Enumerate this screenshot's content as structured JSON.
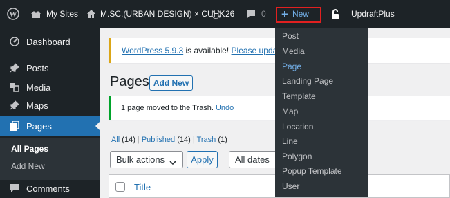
{
  "adminbar": {
    "my_sites": "My Sites",
    "site_name": "M.SC.(URBAN DESIGN) × CUHK",
    "updates_count": "26",
    "comments_count": "0",
    "new_label": "New",
    "plugin_label": "UpdraftPlus"
  },
  "sidebar": {
    "items": [
      {
        "label": "Dashboard",
        "icon": "dashboard-icon"
      },
      {
        "label": "Posts",
        "icon": "pin-icon"
      },
      {
        "label": "Media",
        "icon": "media-icon"
      },
      {
        "label": "Maps",
        "icon": "pin-icon"
      },
      {
        "label": "Pages",
        "icon": "pages-icon"
      },
      {
        "label": "Comments",
        "icon": "comment-icon"
      }
    ],
    "submenu": [
      "All Pages",
      "Add New"
    ]
  },
  "main": {
    "update_notice": {
      "version_link": "WordPress 5.9.3",
      "text": " is available! ",
      "action_link": "Please upda"
    },
    "title": "Pages",
    "add_new": "Add New",
    "trash_notice": {
      "text": "1 page moved to the Trash. ",
      "undo": "Undo"
    },
    "filters": {
      "all": "All",
      "all_count": " (14)",
      "sep1": " | ",
      "published": "Published",
      "published_count": " (14)",
      "sep2": " | ",
      "trash": "Trash",
      "trash_count": " (1)"
    },
    "bulk_actions": "Bulk actions",
    "apply": "Apply",
    "all_dates": "All dates",
    "column_title": "Title"
  },
  "new_menu": [
    "Post",
    "Media",
    "Page",
    "Landing Page",
    "Template",
    "Map",
    "Location",
    "Line",
    "Polygon",
    "Popup Template",
    "User"
  ],
  "colors": {
    "adminbar": "#1d2327",
    "accent": "#2271b1",
    "highlight": "#e02020",
    "submenu_active": "#72aee6"
  }
}
